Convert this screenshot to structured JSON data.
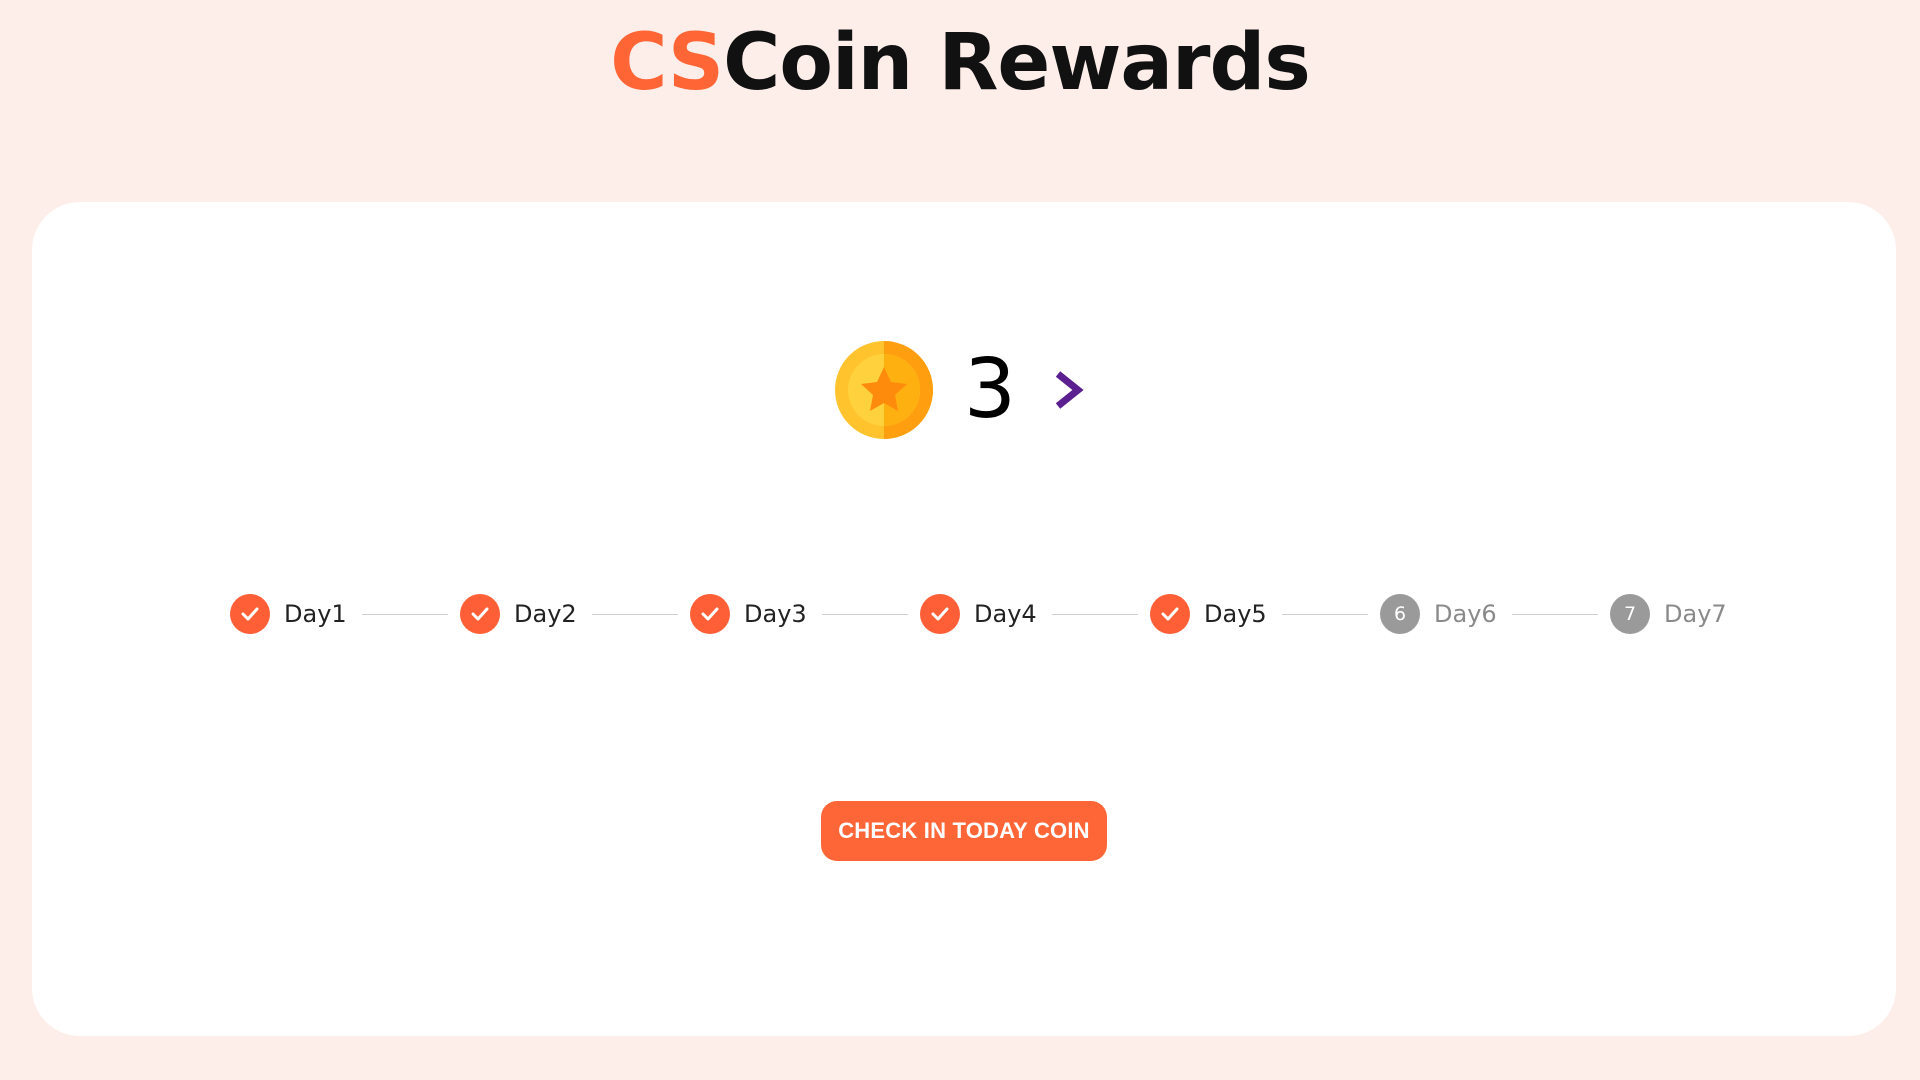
{
  "header": {
    "title_accent": "CS",
    "title_rest": "Coin Rewards",
    "accent_color": "#ff6535"
  },
  "balance": {
    "icon": "coin-icon",
    "value": "3",
    "action_icon": "chevron-right-icon",
    "action_color": "#5b1f8f"
  },
  "checkin": {
    "days": [
      {
        "label": "Day1",
        "status": "done",
        "marker": ""
      },
      {
        "label": "Day2",
        "status": "done",
        "marker": ""
      },
      {
        "label": "Day3",
        "status": "done",
        "marker": ""
      },
      {
        "label": "Day4",
        "status": "done",
        "marker": ""
      },
      {
        "label": "Day5",
        "status": "done",
        "marker": ""
      },
      {
        "label": "Day6",
        "status": "pending",
        "marker": "6"
      },
      {
        "label": "Day7",
        "status": "pending",
        "marker": "7"
      }
    ],
    "done_color": "#ff5f36",
    "pending_color": "#9a9a9a"
  },
  "cta": {
    "label": "CHECK IN TODAY COIN",
    "color": "#ff6637"
  }
}
